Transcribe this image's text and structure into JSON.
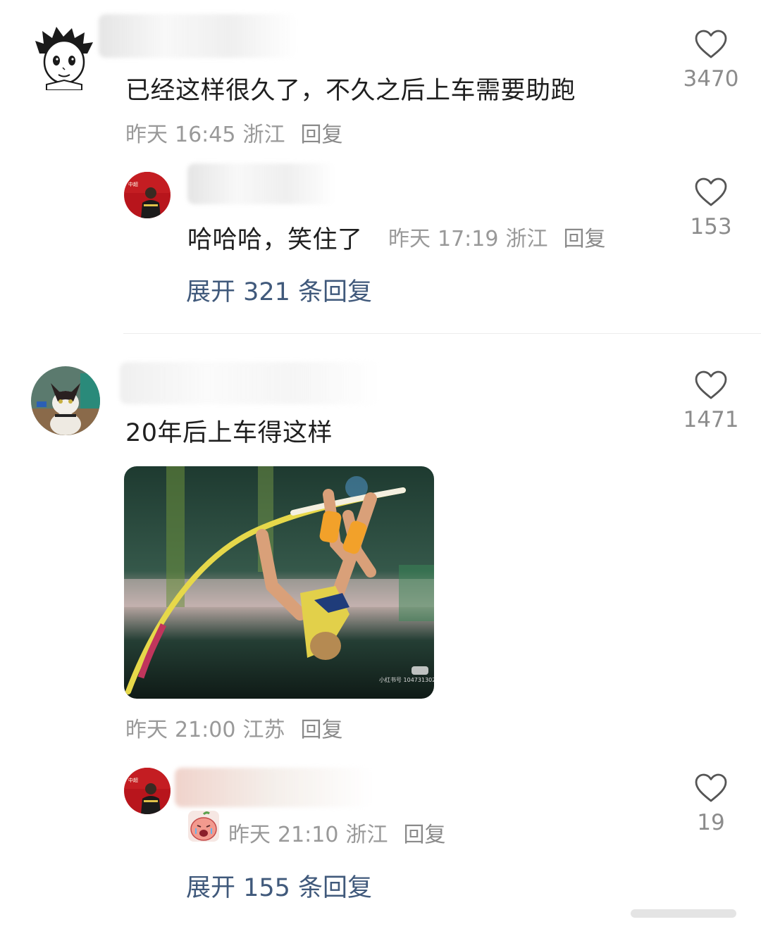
{
  "comments": [
    {
      "text": "已经这样很久了，不久之后上车需要助跑",
      "date": "昨天",
      "time": "16:45",
      "location": "浙江",
      "reply_label": "回复",
      "likes": "3470",
      "avatar_icon": "cartoon-boy-avatar",
      "sub_reply": {
        "text": "哈哈哈，笑住了",
        "date": "昨天",
        "time": "17:19",
        "location": "浙江",
        "reply_label": "回复",
        "likes": "153",
        "avatar_icon": "athlete-photo-avatar"
      },
      "expand_label": "展开 321 条回复"
    },
    {
      "text": "20年后上车得这样",
      "date": "昨天",
      "time": "21:00",
      "location": "江苏",
      "reply_label": "回复",
      "likes": "1471",
      "avatar_icon": "cat-photo-avatar",
      "image_icon": "pole-vault-photo",
      "sub_reply": {
        "date": "昨天",
        "time": "21:10",
        "location": "浙江",
        "reply_label": "回复",
        "likes": "19",
        "emoji_icon": "crying-peach-emoji",
        "avatar_icon": "athlete-photo-avatar"
      },
      "expand_label": "展开 155 条回复"
    }
  ],
  "colors": {
    "link": "#40597b",
    "meta": "#999999",
    "text": "#1f1f1f"
  }
}
